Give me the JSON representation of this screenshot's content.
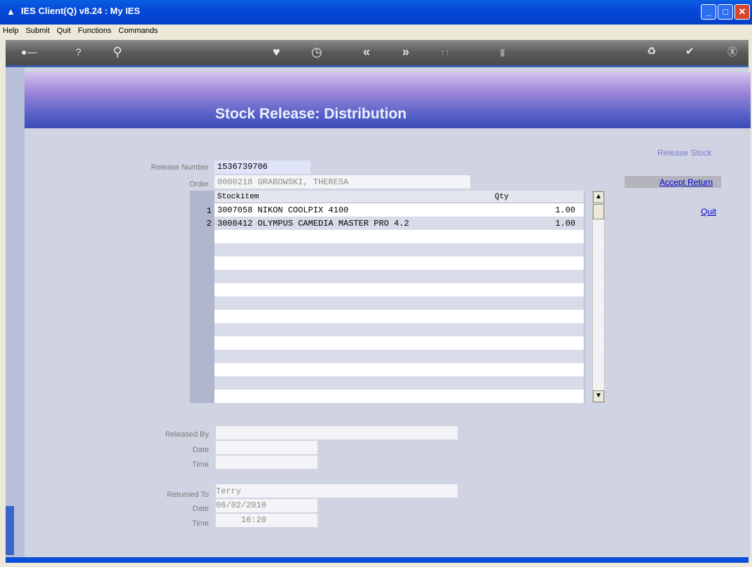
{
  "window": {
    "title": "IES Client(Q) v8.24 : My IES"
  },
  "menu": [
    "Help",
    "Submit",
    "Quit",
    "Functions",
    "Commands"
  ],
  "toolbar": {
    "icons": [
      "key-icon",
      "help-icon",
      "search-icon",
      "heart-icon",
      "clock-icon",
      "back-icon",
      "forward-icon",
      "tools-icon",
      "database-icon",
      "recycle-icon",
      "check-icon",
      "close-icon"
    ]
  },
  "page": {
    "title": "Stock Release: Distribution"
  },
  "form": {
    "release_number_label": "Release Number",
    "release_number": "1536739706",
    "order_label": "Order",
    "order": "0000218 GRABOWSKI, THERESA",
    "grid_header": {
      "stockitem": "Stockitem",
      "qty": "Qty"
    },
    "rows": [
      {
        "idx": "1",
        "item": "3007058 NIKON COOLPIX 4100",
        "qty": "1.00"
      },
      {
        "idx": "2",
        "item": "3008412 OLYMPUS CAMEDIA MASTER PRO 4.2",
        "qty": "1.00"
      }
    ],
    "released_by_label": "Released By",
    "released_by": "",
    "date_label": "Date",
    "released_date": "",
    "time_label": "Time",
    "released_time": "",
    "returned_to_label": "Returned To",
    "returned_to": "Terry",
    "returned_date": "06/02/2010",
    "returned_time": "16:20"
  },
  "actions": {
    "release_stock": "Release Stock",
    "accept_return": "Accept Return",
    "quit": "Quit"
  },
  "colors": {
    "accent": "#0a246a",
    "link": "#0000cc",
    "disabled_link": "#7a7ad0"
  }
}
